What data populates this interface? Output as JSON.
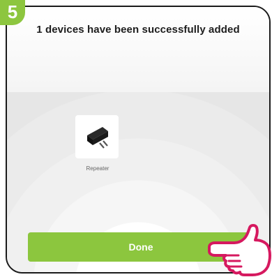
{
  "step": {
    "number": "5"
  },
  "title": "1 devices have been successfully added",
  "device": {
    "name": "Repeater",
    "icon": "plug-adapter-icon"
  },
  "done_button": {
    "label": "Done"
  },
  "colors": {
    "accent": "#8cc63e",
    "badge": "#8dc63f",
    "hand_outline": "#d6195f"
  }
}
